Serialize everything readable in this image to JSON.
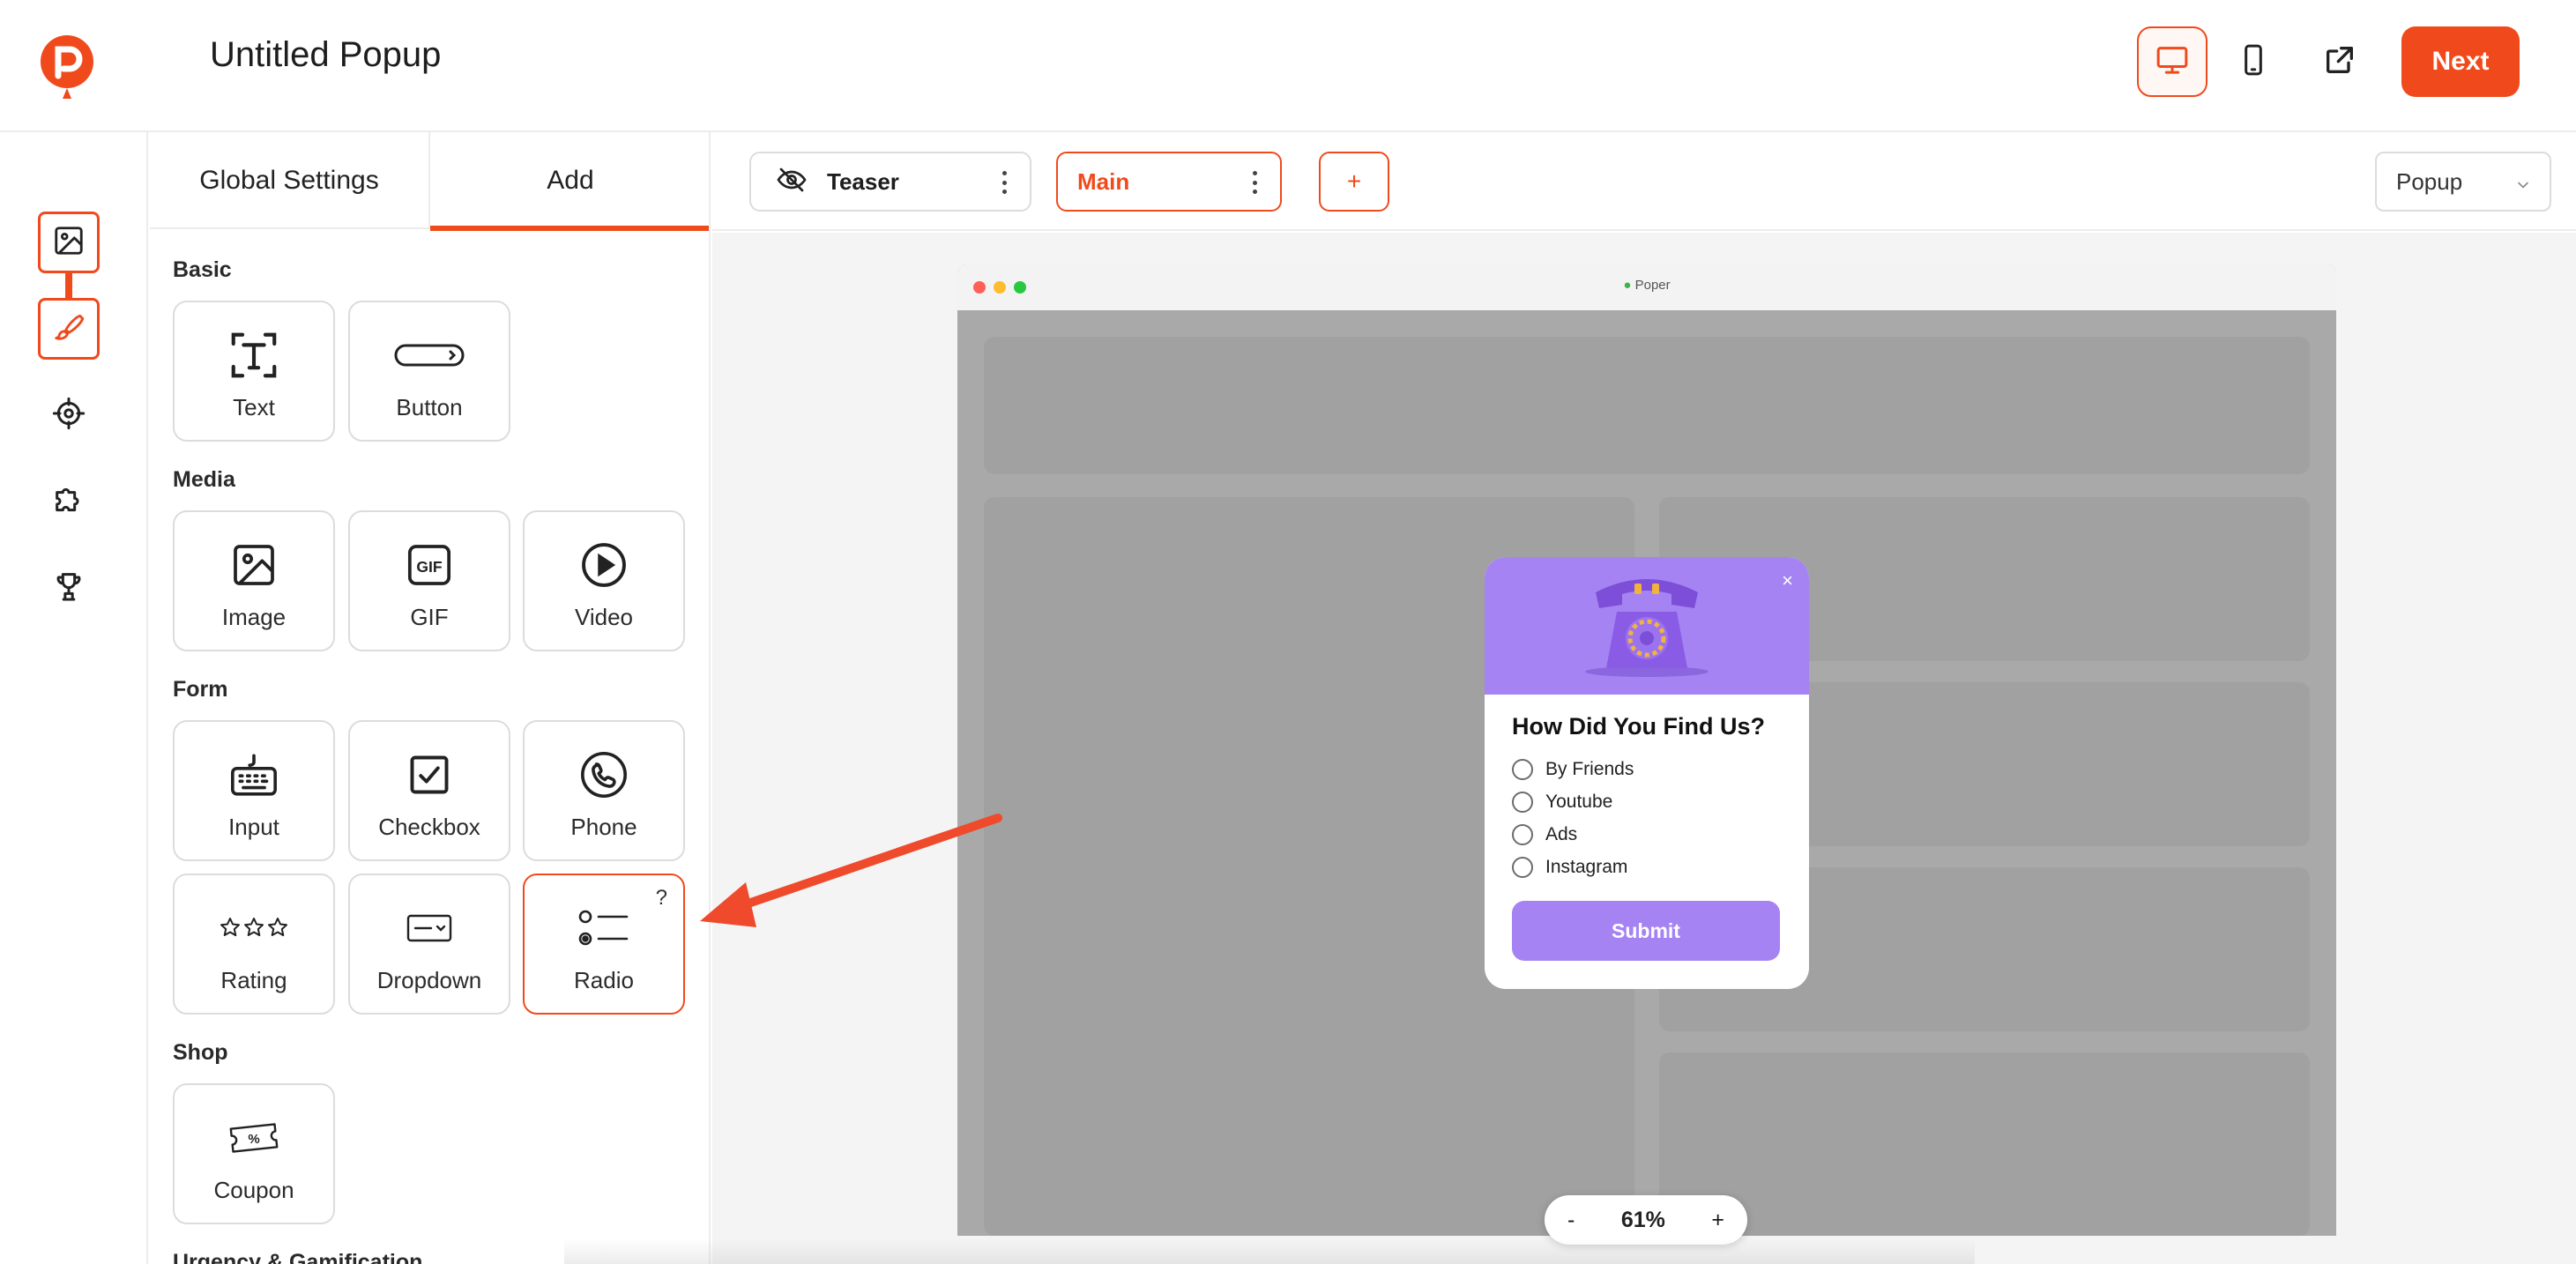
{
  "app": {
    "title": "Untitled Popup",
    "next_label": "Next",
    "accent_color": "#f04a1c"
  },
  "devices": [
    {
      "name": "desktop-icon",
      "active": true
    },
    {
      "name": "mobile-icon",
      "active": false
    },
    {
      "name": "external-link-icon",
      "active": false
    }
  ],
  "rail": [
    "image-icon",
    "brush-icon",
    "target-icon",
    "puzzle-icon",
    "trophy-icon"
  ],
  "panel": {
    "tabs": [
      "Global Settings",
      "Add"
    ],
    "active_tab": "Add",
    "sections": {
      "basic": "Basic",
      "media": "Media",
      "form": "Form",
      "shop": "Shop",
      "urgency": "Urgency & Gamification"
    },
    "tiles": {
      "text": "Text",
      "button": "Button",
      "image": "Image",
      "gif": "GIF",
      "video": "Video",
      "input": "Input",
      "checkbox": "Checkbox",
      "phone": "Phone",
      "rating": "Rating",
      "dropdown": "Dropdown",
      "radio": "Radio",
      "coupon": "Coupon"
    },
    "radio_help": "?"
  },
  "steps": {
    "teaser": "Teaser",
    "main": "Main",
    "add": "+",
    "active": "Main"
  },
  "popup_type": "Popup",
  "browser": {
    "url": "Poper"
  },
  "popup": {
    "close": "×",
    "question": "How Did You Find Us?",
    "options": [
      "By Friends",
      "Youtube",
      "Ads",
      "Instagram"
    ],
    "submit": "Submit",
    "color": "#a583f2"
  },
  "zoom": {
    "minus": "-",
    "value": "61%",
    "plus": "+"
  }
}
